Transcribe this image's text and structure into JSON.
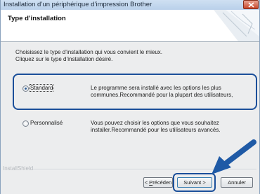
{
  "window": {
    "title": "Installation d’un périphérique d’impression Brother",
    "close_icon": "close-icon"
  },
  "header": {
    "title": "Type d’installation"
  },
  "instructions": {
    "line1": "Choisissez le type d’installation qui vous convient le mieux.",
    "line2": "Cliquez sur le type d’installation désiré."
  },
  "options": [
    {
      "label": "Standard",
      "selected": true,
      "desc_line1": "Le programme sera installé avec les options les plus",
      "desc_line2": "communes.Recommandé pour la plupart des utilisateurs,"
    },
    {
      "label": "Personnalisé",
      "selected": false,
      "desc_line1": "Vous pouvez choisir les options que vous souhaitez",
      "desc_line2": "installer.Recommandé pour les utilisateurs avancés."
    }
  ],
  "footer": {
    "brand": "InstallShield",
    "prev_prefix": "< ",
    "prev_mnemonic": "P",
    "prev_rest": "récéden",
    "next_label": "Suivant >",
    "cancel_label": "Annuler"
  },
  "colors": {
    "highlight": "#1b4f9a",
    "arrow": "#1f5aa6"
  }
}
